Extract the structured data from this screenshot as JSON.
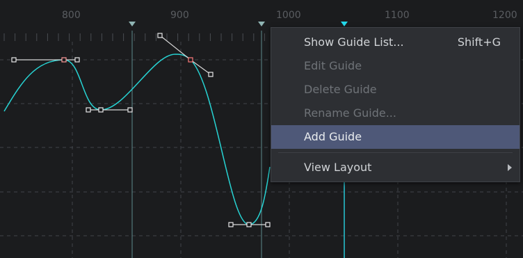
{
  "ruler": {
    "ticks": [
      "800",
      "900",
      "1000",
      "1100",
      "1200"
    ]
  },
  "context_menu": {
    "items": [
      {
        "label": "Show Guide List...",
        "shortcut": "Shift+G",
        "enabled": true
      },
      {
        "label": "Edit Guide",
        "enabled": false
      },
      {
        "label": "Delete Guide",
        "enabled": false
      },
      {
        "label": "Rename Guide...",
        "enabled": false
      },
      {
        "label": "Add Guide",
        "enabled": true,
        "highlighted": true
      },
      {
        "label": "View Layout",
        "enabled": true,
        "has_submenu": true
      }
    ]
  },
  "colors": {
    "curve": "#27d3d3",
    "guide_line": "#5e8a8c",
    "highlight": "#4e5878",
    "background": "#1b1c1e"
  }
}
